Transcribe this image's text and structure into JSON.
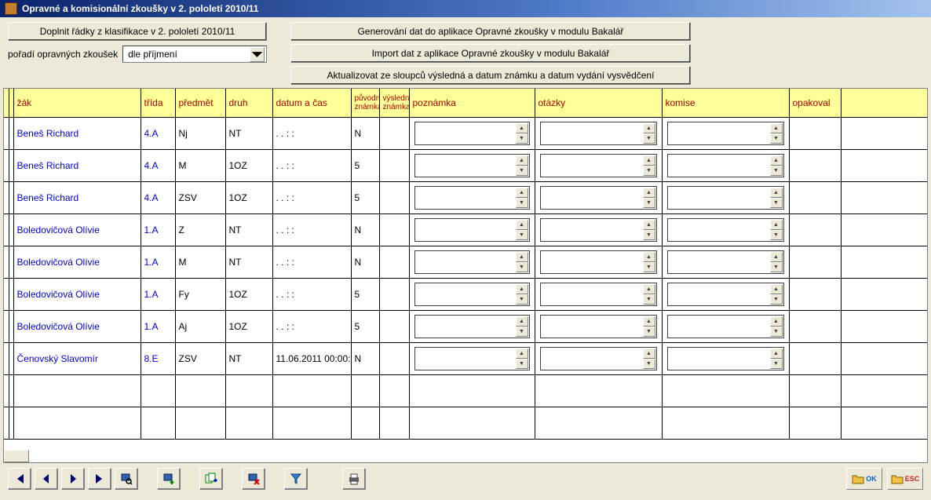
{
  "window": {
    "title": "Opravné a komisionální zkoušky v 2. pololetí 2010/11"
  },
  "toolbar": {
    "doplnit_label": "Doplnit řádky z klasifikace v 2. pololetí 2010/11",
    "generovani_label": "Generování dat do aplikace Opravné zkoušky v modulu Bakalář",
    "import_label": "Import dat z aplikace Opravné zkoušky v modulu Bakalář",
    "aktualizovat_label": "Aktualizovat ze sloupců výsledná a datum známku a datum vydání vysvědčení",
    "poradi_label": "pořadí opravných zkoušek",
    "poradi_value": "dle příjmení"
  },
  "headers": {
    "zak": "žák",
    "trida": "třída",
    "predmet": "předmět",
    "druh": "druh",
    "datum": "datum a čas",
    "puvodni": "původní známka",
    "vysledna": "výsledná známka",
    "poznamka": "poznámka",
    "otazky": "otázky",
    "komise": "komise",
    "opakoval": "opakoval"
  },
  "rows": [
    {
      "zak": "Beneš Richard",
      "trida": "4.A",
      "predmet": "Nj",
      "druh": "NT",
      "datum": " .  .       :  :",
      "puv": "N",
      "vys": ""
    },
    {
      "zak": "Beneš Richard",
      "trida": "4.A",
      "predmet": "M",
      "druh": "1OZ",
      "datum": " .  .       :  :",
      "puv": "5",
      "vys": ""
    },
    {
      "zak": "Beneš Richard",
      "trida": "4.A",
      "predmet": "ZSV",
      "druh": "1OZ",
      "datum": " .  .       :  :",
      "puv": "5",
      "vys": ""
    },
    {
      "zak": "Boledovičová Olívie",
      "trida": "1.A",
      "predmet": "Z",
      "druh": "NT",
      "datum": " .  .       :  :",
      "puv": "N",
      "vys": ""
    },
    {
      "zak": "Boledovičová Olívie",
      "trida": "1.A",
      "predmet": "M",
      "druh": "NT",
      "datum": " .  .       :  :",
      "puv": "N",
      "vys": ""
    },
    {
      "zak": "Boledovičová Olívie",
      "trida": "1.A",
      "predmet": "Fy",
      "druh": "1OZ",
      "datum": " .  .       :  :",
      "puv": "5",
      "vys": ""
    },
    {
      "zak": "Boledovičová Olívie",
      "trida": "1.A",
      "predmet": "Aj",
      "druh": "1OZ",
      "datum": " .  .       :  :",
      "puv": "5",
      "vys": ""
    },
    {
      "zak": "Čenovský Slavomír",
      "trida": "8.E",
      "predmet": "ZSV",
      "druh": "NT",
      "datum": "11.06.2011 00:00:",
      "puv": "N",
      "vys": ""
    }
  ],
  "bottom": {
    "ok_label": "OK",
    "esc_label": "ESC"
  }
}
